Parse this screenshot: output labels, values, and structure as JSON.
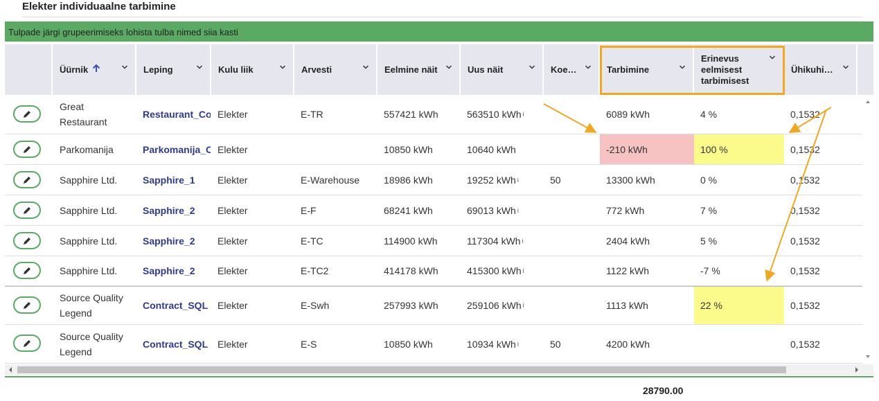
{
  "page": {
    "title": "Elekter individuaalne tarbimine"
  },
  "grouping": {
    "hint": "Tulpade järgi grupeerimiseks lohista tulba nimed siia kasti"
  },
  "columns": {
    "yurnik": "Üürnik",
    "leping": "Leping",
    "kulu_liik": "Kulu liik",
    "arvesti": "Arvesti",
    "eelmine": "Eelmine näit",
    "uus": "Uus näit",
    "koef": "Koe…",
    "tarbimine": "Tarbimine",
    "erinevus_1": "Erinevus",
    "erinevus_2": "eelmisest",
    "erinevus_3": "tarbimisest",
    "uhikuhind": "Ühikuhi…"
  },
  "rows": [
    {
      "tenant_1": "Great",
      "tenant_2": "Restaurant",
      "contract": "Restaurant_Con",
      "cost_type": "Elekter",
      "meter": "E-TR",
      "prev": "557421 kWh",
      "new": "563510 kWh",
      "new_info": "i",
      "coef": "",
      "consumption": "6089 kWh",
      "diff": "4 %",
      "unit": "0,1532"
    },
    {
      "tenant_1": "Parkomanija",
      "tenant_2": "",
      "contract": "Parkomanija_Co",
      "cost_type": "Elekter",
      "meter": "",
      "prev": "10850 kWh",
      "new": "10640 kWh",
      "new_info": "",
      "coef": "",
      "consumption": "-210 kWh",
      "diff": "100 %",
      "unit": "0,1532"
    },
    {
      "tenant_1": "Sapphire Ltd.",
      "tenant_2": "",
      "contract": "Sapphire_1",
      "cost_type": "Elekter",
      "meter": "E-Warehouse",
      "prev": "18986 kWh",
      "new": "19252 kWh",
      "new_info": "i",
      "coef": "50",
      "consumption": "13300 kWh",
      "diff": "0 %",
      "unit": "0,1532"
    },
    {
      "tenant_1": "Sapphire Ltd.",
      "tenant_2": "",
      "contract": "Sapphire_2",
      "cost_type": "Elekter",
      "meter": "E-F",
      "prev": "68241 kWh",
      "new": "69013 kWh",
      "new_info": "i",
      "coef": "",
      "consumption": "772 kWh",
      "diff": "7 %",
      "unit": "0,1532"
    },
    {
      "tenant_1": "Sapphire Ltd.",
      "tenant_2": "",
      "contract": "Sapphire_2",
      "cost_type": "Elekter",
      "meter": "E-TC",
      "prev": "114900 kWh",
      "new": "117304 kWh",
      "new_info": "i",
      "coef": "",
      "consumption": "2404 kWh",
      "diff": "5 %",
      "unit": "0,1532"
    },
    {
      "tenant_1": "Sapphire Ltd.",
      "tenant_2": "",
      "contract": "Sapphire_2",
      "cost_type": "Elekter",
      "meter": "E-TC2",
      "prev": "414178 kWh",
      "new": "415300 kWh",
      "new_info": "i",
      "coef": "",
      "consumption": "1122 kWh",
      "diff": "-7 %",
      "unit": "0,1532"
    },
    {
      "tenant_1": "Source Quality",
      "tenant_2": "Legend",
      "contract": "Contract_SQL",
      "cost_type": "Elekter",
      "meter": "E-Swh",
      "prev": "257993 kWh",
      "new": "259106 kWh",
      "new_info": "i",
      "coef": "",
      "consumption": "1113 kWh",
      "diff": "22 %",
      "unit": "0,1532"
    },
    {
      "tenant_1": "Source Quality",
      "tenant_2": "Legend",
      "contract": "Contract_SQL",
      "cost_type": "Elekter",
      "meter": "E-S",
      "prev": "10850 kWh",
      "new": "10934 kWh",
      "new_info": "i",
      "coef": "50",
      "consumption": "4200 kWh",
      "diff": "",
      "unit": "0,1532"
    }
  ],
  "footer": {
    "total": "28790.00"
  },
  "colors": {
    "accent_green": "#5aaa63",
    "link_blue": "#2c3a8f",
    "highlight_red": "#f7c2c2",
    "highlight_yellow": "#fbfb8b",
    "annotation_orange": "#f0a81e"
  },
  "icons": {
    "edit": "pencil-icon",
    "sort": "arrow-up-icon",
    "menu": "chevron-down-icon"
  }
}
